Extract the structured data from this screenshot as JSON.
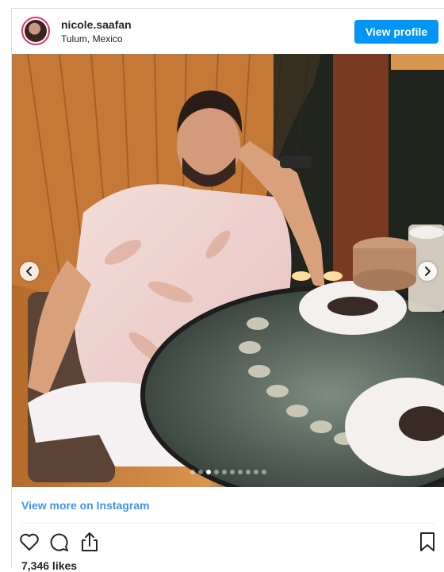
{
  "post": {
    "username": "nicole.saafan",
    "location": "Tulum, Mexico",
    "view_profile_label": "View profile",
    "view_more_label": "View more on Instagram",
    "likes_text": "7,346 likes"
  },
  "carousel": {
    "slide_count": 10,
    "active_index": 2
  },
  "icons": {
    "prev": "chevron-left-icon",
    "next": "chevron-right-icon",
    "like": "heart-icon",
    "comment": "comment-icon",
    "share": "share-icon",
    "save": "bookmark-icon"
  },
  "colors": {
    "accent": "#0095f6",
    "link": "#3897f0"
  }
}
